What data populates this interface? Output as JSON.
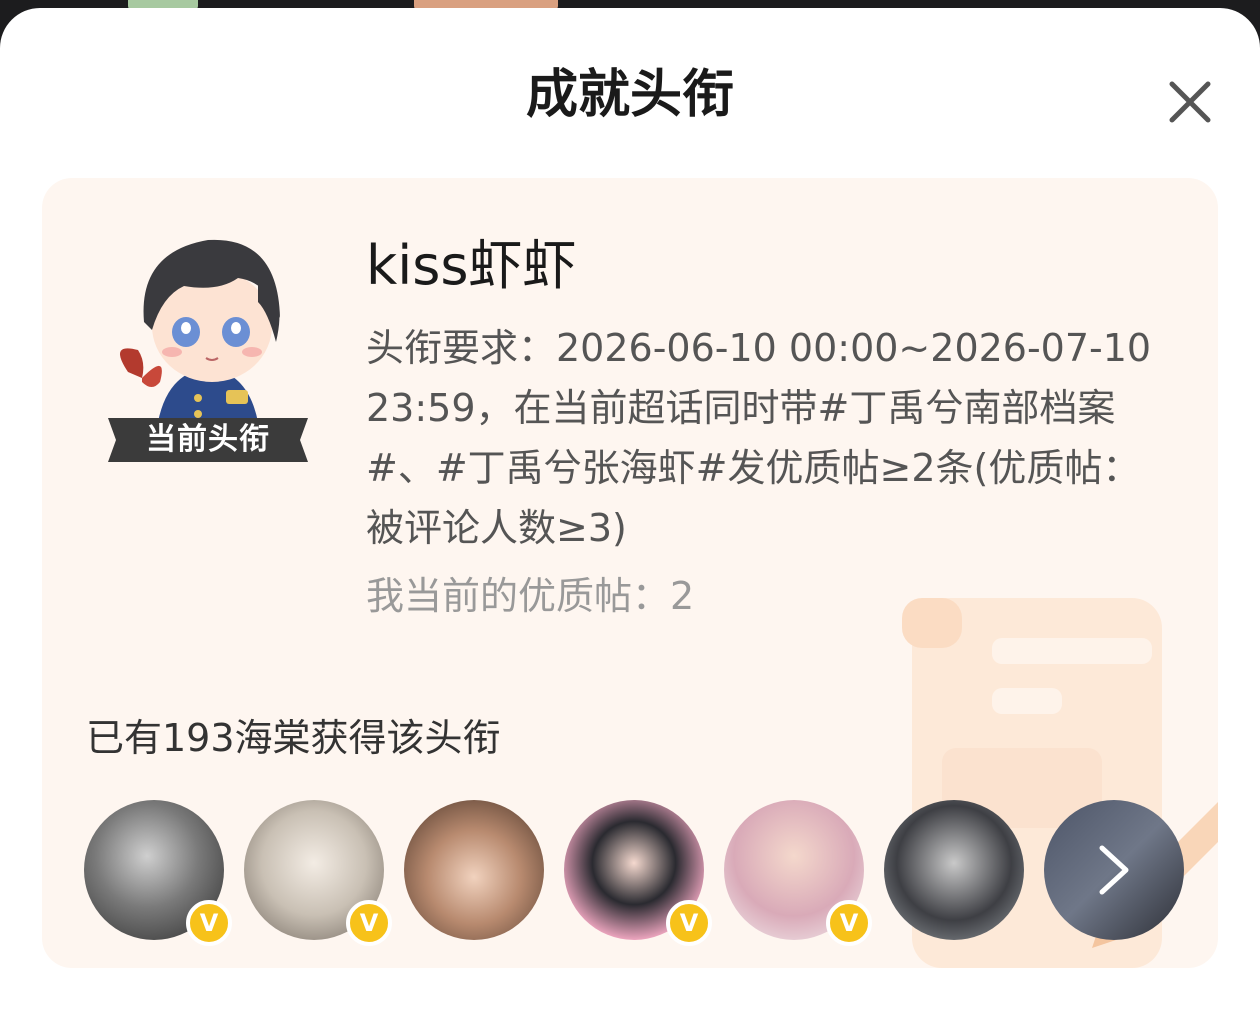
{
  "colors": {
    "sheet_bg": "#ffffff",
    "card_bg": "#fef6f0",
    "verified_badge": "#f7c21a",
    "title_text": "#1a1a1a",
    "secondary_text": "#999999"
  },
  "modal": {
    "title": "成就头衔",
    "close_icon": "close-icon"
  },
  "badge": {
    "ribbon_label": "当前头衔",
    "name": "kiss虾虾",
    "requirement": "头衔要求：2026-06-10 00:00~2026-07-10 23:59，在当前超话同时带#丁禹兮南部档案#、#丁禹兮张海虾#发优质帖≥2条(优质帖：被评论人数≥3)",
    "my_count_label": "我当前的优质帖：",
    "my_count_value": "2"
  },
  "owners": {
    "summary": "已有193海棠获得该头衔",
    "avatars": [
      {
        "name": "avatar-1",
        "verified": true
      },
      {
        "name": "avatar-2",
        "verified": true
      },
      {
        "name": "avatar-3",
        "verified": false
      },
      {
        "name": "avatar-4",
        "verified": true
      },
      {
        "name": "avatar-5",
        "verified": true
      },
      {
        "name": "avatar-6",
        "verified": false
      }
    ],
    "more_icon": "chevron-right-icon",
    "verified_icon": "v-icon",
    "verified_glyph": "V"
  }
}
